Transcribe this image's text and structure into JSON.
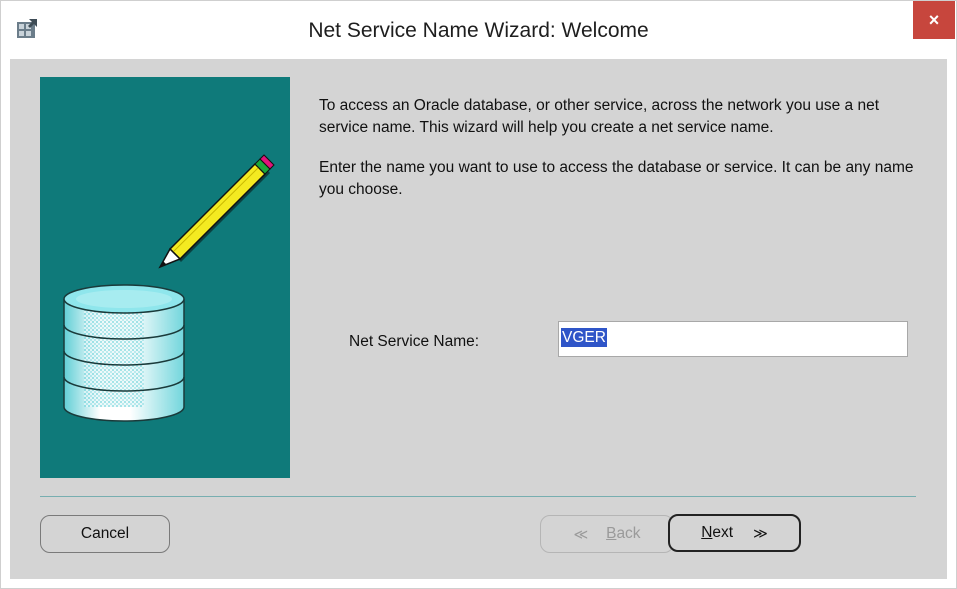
{
  "window": {
    "title": "Net Service Name Wizard: Welcome",
    "close_glyph": "×"
  },
  "icons": {
    "app": "oracle-net-icon",
    "close": "close-icon",
    "illustration": "database-pencil-illustration",
    "back_arrow": "chevron-double-left-icon",
    "next_arrow": "chevron-double-right-icon"
  },
  "intro": {
    "paragraph1": "To access an Oracle database, or other service, across the network you use a net service name.  This wizard will help you create a net service name.",
    "paragraph2": "Enter the name you want to use to access the database or service. It can be any name you choose."
  },
  "form": {
    "label": "Net Service Name:",
    "value": "VGER"
  },
  "buttons": {
    "cancel": "Cancel",
    "back_mnemonic": "B",
    "back_rest": "ack",
    "back_arrow": "≪",
    "next_mnemonic": "N",
    "next_rest": "ext",
    "next_arrow": "≫"
  },
  "colors": {
    "panel": "#0f7a7a",
    "dialog_bg": "#d4d4d4",
    "close_button": "#c7463d",
    "selection": "#2f55c8"
  }
}
